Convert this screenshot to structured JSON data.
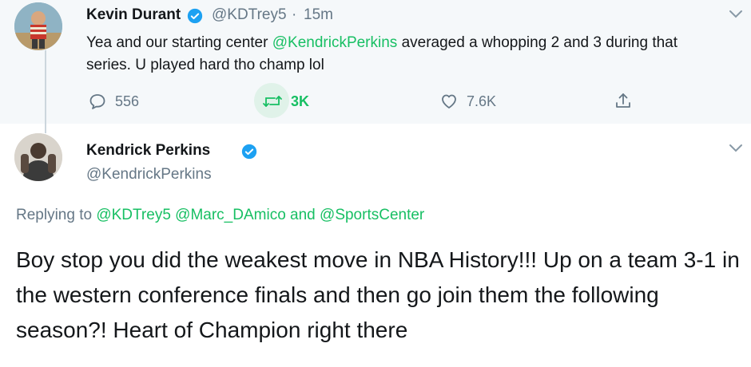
{
  "tweet1": {
    "author_name": "Kevin Durant",
    "author_handle": "@KDTrey5",
    "separator": "·",
    "time": "15m",
    "text_before": "Yea and our starting center ",
    "mention": "@KendrickPerkins",
    "text_after": " averaged a whopping 2 and 3 during that series. U played hard tho champ lol",
    "reply_count": "556",
    "retweet_count": "3K",
    "like_count": "7.6K"
  },
  "tweet2": {
    "author_name": "Kendrick Perkins",
    "author_handle": "@KendrickPerkins",
    "replying_label": "Replying to",
    "reply_to_1": "@KDTrey5",
    "reply_to_2": "@Marc_DAmico",
    "and_label": "and",
    "reply_to_3": "@SportsCenter",
    "text": "Boy stop you did the weakest move in NBA History!!! Up on a team 3-1 in the western conference finals and then go join them the following season?! Heart of Champion right there"
  },
  "colors": {
    "accent_green": "#17bf63",
    "muted": "#657786",
    "verified_blue": "#1da1f2",
    "highlight_bg": "#f5f8fa"
  },
  "icons": [
    "verified-badge-icon",
    "chevron-down-icon",
    "reply-icon",
    "retweet-icon",
    "like-icon",
    "share-icon"
  ]
}
